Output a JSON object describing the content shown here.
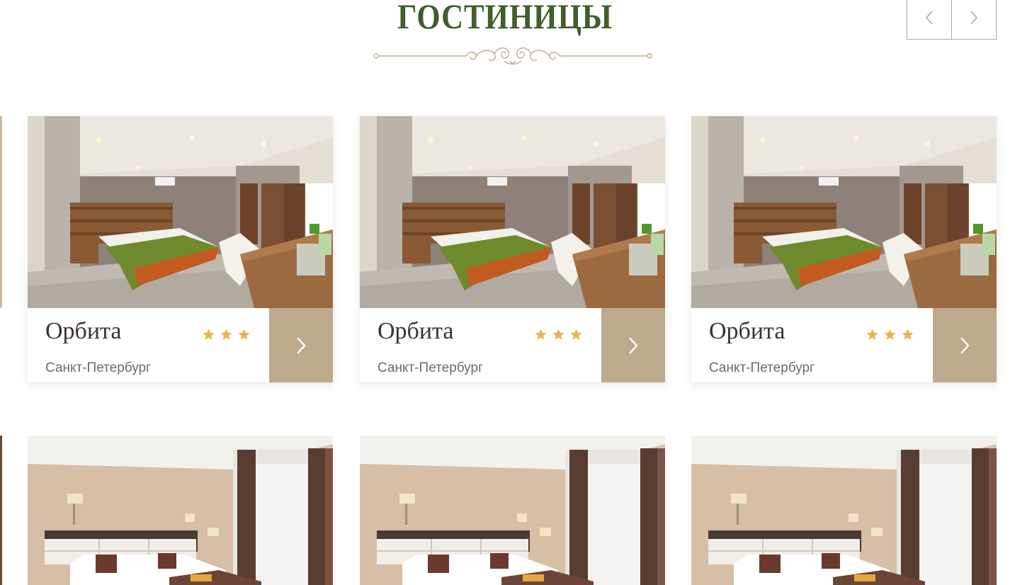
{
  "section": {
    "title": "ГОСТИНИЦЫ"
  },
  "nav": {
    "prev_icon": "chevron-left-icon",
    "next_icon": "chevron-right-icon"
  },
  "colors": {
    "title_green": "#3f5f2b",
    "accent_tan": "#bda98e",
    "star_gold": "#e3b64f",
    "border_tan": "#b8a58c"
  },
  "hotels_row1": [
    {
      "name": "Орбита",
      "city": "Санкт-Петербург",
      "stars": 3
    },
    {
      "name": "Орбита",
      "city": "Санкт-Петербург",
      "stars": 3
    },
    {
      "name": "Орбита",
      "city": "Санкт-Петербург",
      "stars": 3
    }
  ]
}
